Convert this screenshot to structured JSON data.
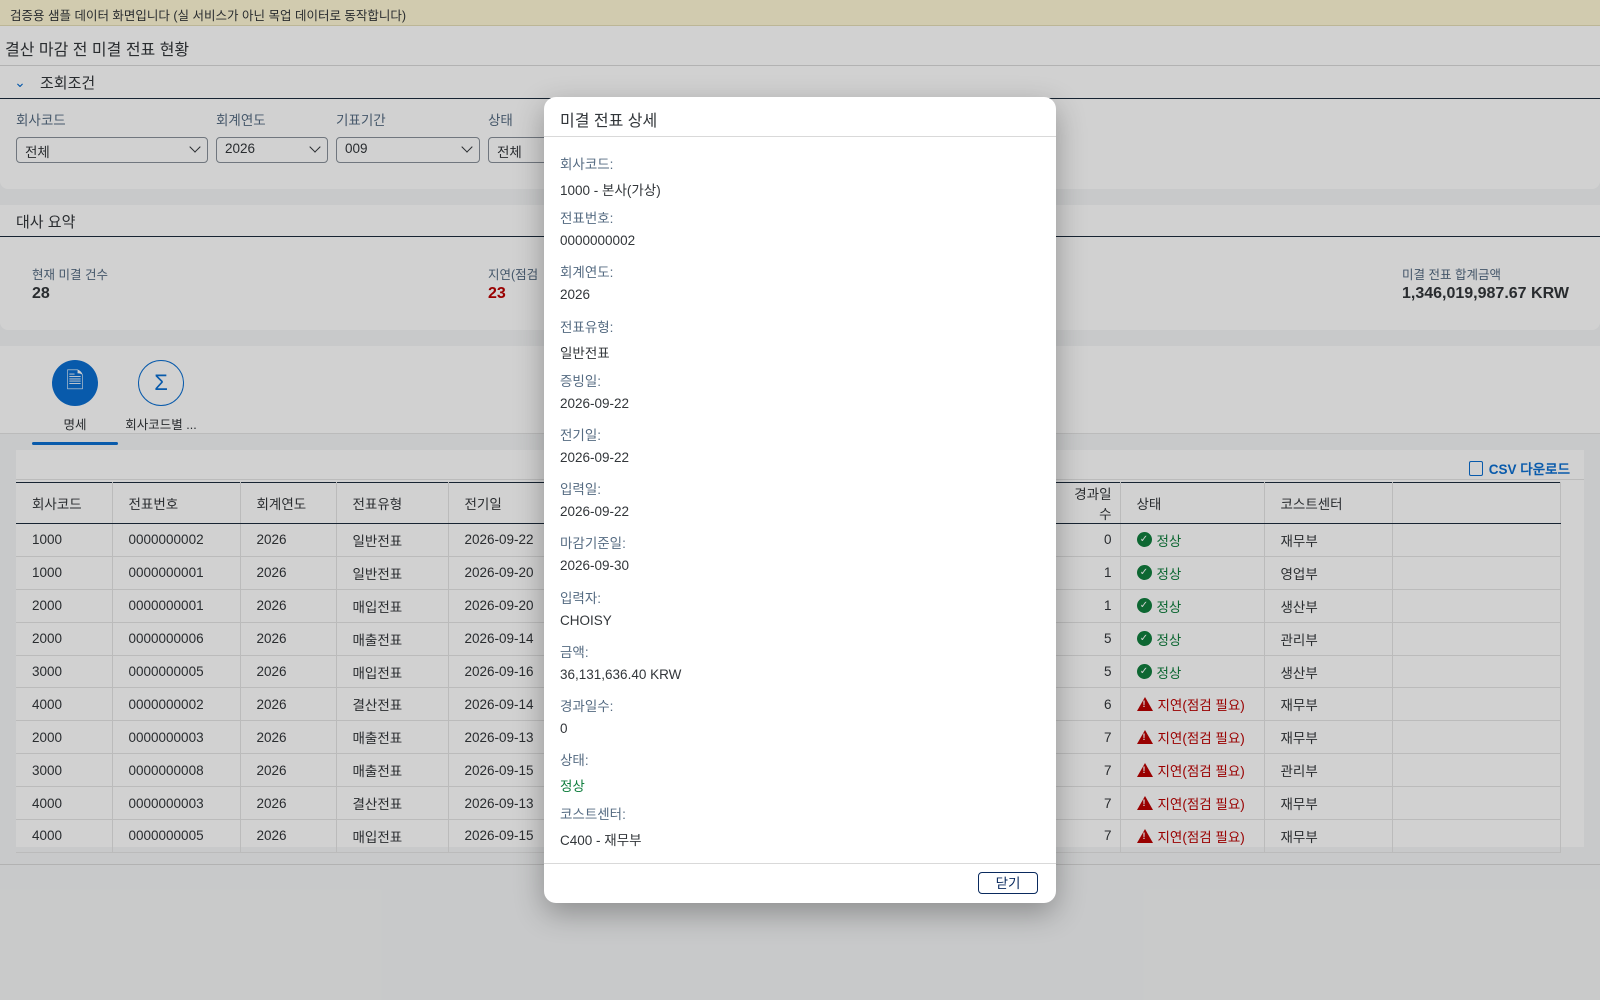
{
  "banner": "검증용 샘플 데이터 화면입니다 (실 서비스가 아닌 목업 데이터로 동작합니다)",
  "page_title": "결산 마감 전 미결 전표 현황",
  "filter": {
    "title": "조회조건",
    "fields": [
      {
        "label": "회사코드",
        "value": "전체"
      },
      {
        "label": "회계연도",
        "value": "2026"
      },
      {
        "label": "기표기간",
        "value": "009"
      },
      {
        "label": "상태",
        "value": "전체"
      }
    ]
  },
  "summary": {
    "title": "대사 요약",
    "kpis": [
      {
        "label": "현재 미결 건수",
        "value": "28"
      },
      {
        "label": "지연(점검",
        "value": "23"
      },
      {
        "label": "미결 전표 합계금액",
        "value": "1,346,019,987.67 KRW"
      }
    ]
  },
  "tabs": [
    {
      "label": "명세",
      "icon": "document-search-icon",
      "active": true
    },
    {
      "label": "회사코드별 ...",
      "icon": "sigma-icon",
      "active": false
    }
  ],
  "table": {
    "csv_label": "CSV 다운로드",
    "columns": [
      "회사코드",
      "전표번호",
      "회계연도",
      "전표유형",
      "전기일",
      "경과일수",
      "상태",
      "코스트센터"
    ],
    "rows": [
      {
        "company": "1000",
        "doc": "0000000002",
        "year": "2026",
        "type": "일반전표",
        "posting": "2026-09-22",
        "days": "0",
        "status": "정상",
        "cc": "재무부"
      },
      {
        "company": "1000",
        "doc": "0000000001",
        "year": "2026",
        "type": "일반전표",
        "posting": "2026-09-20",
        "days": "1",
        "status": "정상",
        "cc": "영업부"
      },
      {
        "company": "2000",
        "doc": "0000000001",
        "year": "2026",
        "type": "매입전표",
        "posting": "2026-09-20",
        "days": "1",
        "status": "정상",
        "cc": "생산부"
      },
      {
        "company": "2000",
        "doc": "0000000006",
        "year": "2026",
        "type": "매출전표",
        "posting": "2026-09-14",
        "days": "5",
        "status": "정상",
        "cc": "관리부"
      },
      {
        "company": "3000",
        "doc": "0000000005",
        "year": "2026",
        "type": "매입전표",
        "posting": "2026-09-16",
        "days": "5",
        "status": "정상",
        "cc": "생산부"
      },
      {
        "company": "4000",
        "doc": "0000000002",
        "year": "2026",
        "type": "결산전표",
        "posting": "2026-09-14",
        "days": "6",
        "status": "지연(점검 필요)",
        "cc": "재무부"
      },
      {
        "company": "2000",
        "doc": "0000000003",
        "year": "2026",
        "type": "매출전표",
        "posting": "2026-09-13",
        "days": "7",
        "status": "지연(점검 필요)",
        "cc": "재무부"
      },
      {
        "company": "3000",
        "doc": "0000000008",
        "year": "2026",
        "type": "매출전표",
        "posting": "2026-09-15",
        "days": "7",
        "status": "지연(점검 필요)",
        "cc": "관리부"
      },
      {
        "company": "4000",
        "doc": "0000000003",
        "year": "2026",
        "type": "결산전표",
        "posting": "2026-09-13",
        "days": "7",
        "status": "지연(점검 필요)",
        "cc": "재무부"
      },
      {
        "company": "4000",
        "doc": "0000000005",
        "year": "2026",
        "type": "매입전표",
        "posting": "2026-09-15",
        "days": "7",
        "status": "지연(점검 필요)",
        "cc": "재무부"
      }
    ]
  },
  "dialog": {
    "title": "미결 전표 상세",
    "fields": [
      {
        "label": "회사코드:",
        "value": "1000 - 본사(가상)"
      },
      {
        "label": "전표번호:",
        "value": "0000000002"
      },
      {
        "label": "회계연도:",
        "value": "2026"
      },
      {
        "label": "전표유형:",
        "value": "일반전표"
      },
      {
        "label": "증빙일:",
        "value": "2026-09-22"
      },
      {
        "label": "전기일:",
        "value": "2026-09-22"
      },
      {
        "label": "입력일:",
        "value": "2026-09-22"
      },
      {
        "label": "마감기준일:",
        "value": "2026-09-30"
      },
      {
        "label": "입력자:",
        "value": "CHOISY"
      },
      {
        "label": "금액:",
        "value": "36,131,636.40 KRW"
      },
      {
        "label": "경과일수:",
        "value": "0"
      },
      {
        "label": "상태:",
        "value": "정상"
      },
      {
        "label": "코스트센터:",
        "value": "C400 - 재무부"
      }
    ],
    "close_label": "닫기"
  },
  "colors": {
    "accent": "#0a6ed1",
    "ok": "#107e3e",
    "warn": "#bb0000"
  }
}
